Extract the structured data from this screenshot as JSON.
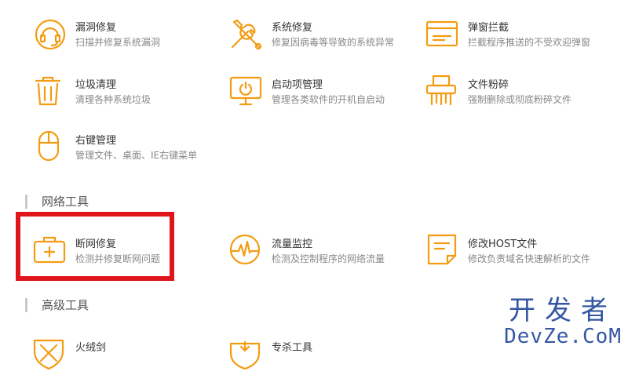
{
  "accent_color": "#f39c12",
  "highlight_color": "#e0151b",
  "system_tools": [
    {
      "icon": "headset-repair-icon",
      "title": "漏洞修复",
      "desc": "扫描并修复系统漏洞"
    },
    {
      "icon": "wrench-screwdriver-icon",
      "title": "系统修复",
      "desc": "修复因病毒等导致的系统异常"
    },
    {
      "icon": "popup-window-icon",
      "title": "弹窗拦截",
      "desc": "拦截程序推送的不受欢迎弹窗"
    },
    {
      "icon": "trash-bin-icon",
      "title": "垃圾清理",
      "desc": "清理各种系统垃圾"
    },
    {
      "icon": "monitor-power-icon",
      "title": "启动项管理",
      "desc": "管理各类软件的开机自启动"
    },
    {
      "icon": "shredder-icon",
      "title": "文件粉碎",
      "desc": "强制删除或彻底粉碎文件"
    },
    {
      "icon": "mouse-icon",
      "title": "右键管理",
      "desc": "管理文件、桌面、IE右键菜单"
    }
  ],
  "network_section": {
    "title": "网络工具",
    "tools": [
      {
        "icon": "first-aid-kit-icon",
        "title": "断网修复",
        "desc": "检测并修复断网问题"
      },
      {
        "icon": "traffic-monitor-icon",
        "title": "流量监控",
        "desc": "检测及控制程序的网络流量"
      },
      {
        "icon": "hosts-file-icon",
        "title": "修改HOST文件",
        "desc": "修改负责域名快速解析的文件"
      }
    ]
  },
  "advanced_section": {
    "title": "高级工具",
    "tools": [
      {
        "icon": "shield-sword-icon",
        "title": "火绒剑"
      },
      {
        "icon": "special-kill-icon",
        "title": "专杀工具"
      }
    ]
  },
  "watermark": {
    "cn": "开发者",
    "en": "DevZe.CoM"
  }
}
